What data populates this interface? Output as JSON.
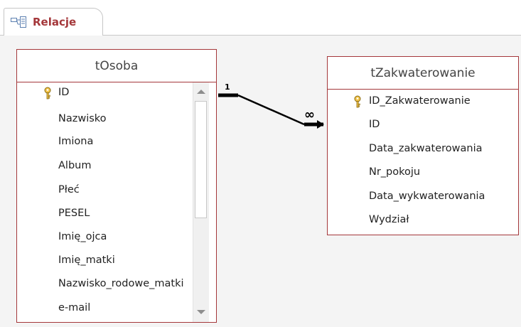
{
  "tab": {
    "label": "Relacje",
    "icon": "relationships-icon"
  },
  "tables": [
    {
      "title": "tOsoba",
      "fields": [
        "ID",
        "Nazwisko",
        "Imiona",
        "Album",
        "Płeć",
        "PESEL",
        "Imię_ojca",
        "Imię_matki",
        "Nazwisko_rodowe_matki",
        "e-mail"
      ],
      "key_field": "ID"
    },
    {
      "title": "tZakwaterowanie",
      "fields": [
        "ID_Zakwaterowanie",
        "ID",
        "Data_zakwaterowania",
        "Nr_pokoju",
        "Data_wykwaterowania",
        "Wydział"
      ],
      "key_field": "ID_Zakwaterowanie"
    }
  ],
  "relationship": {
    "one_label": "1",
    "many_label": "∞"
  },
  "colors": {
    "accent": "#a4373a",
    "line": "#000000"
  }
}
